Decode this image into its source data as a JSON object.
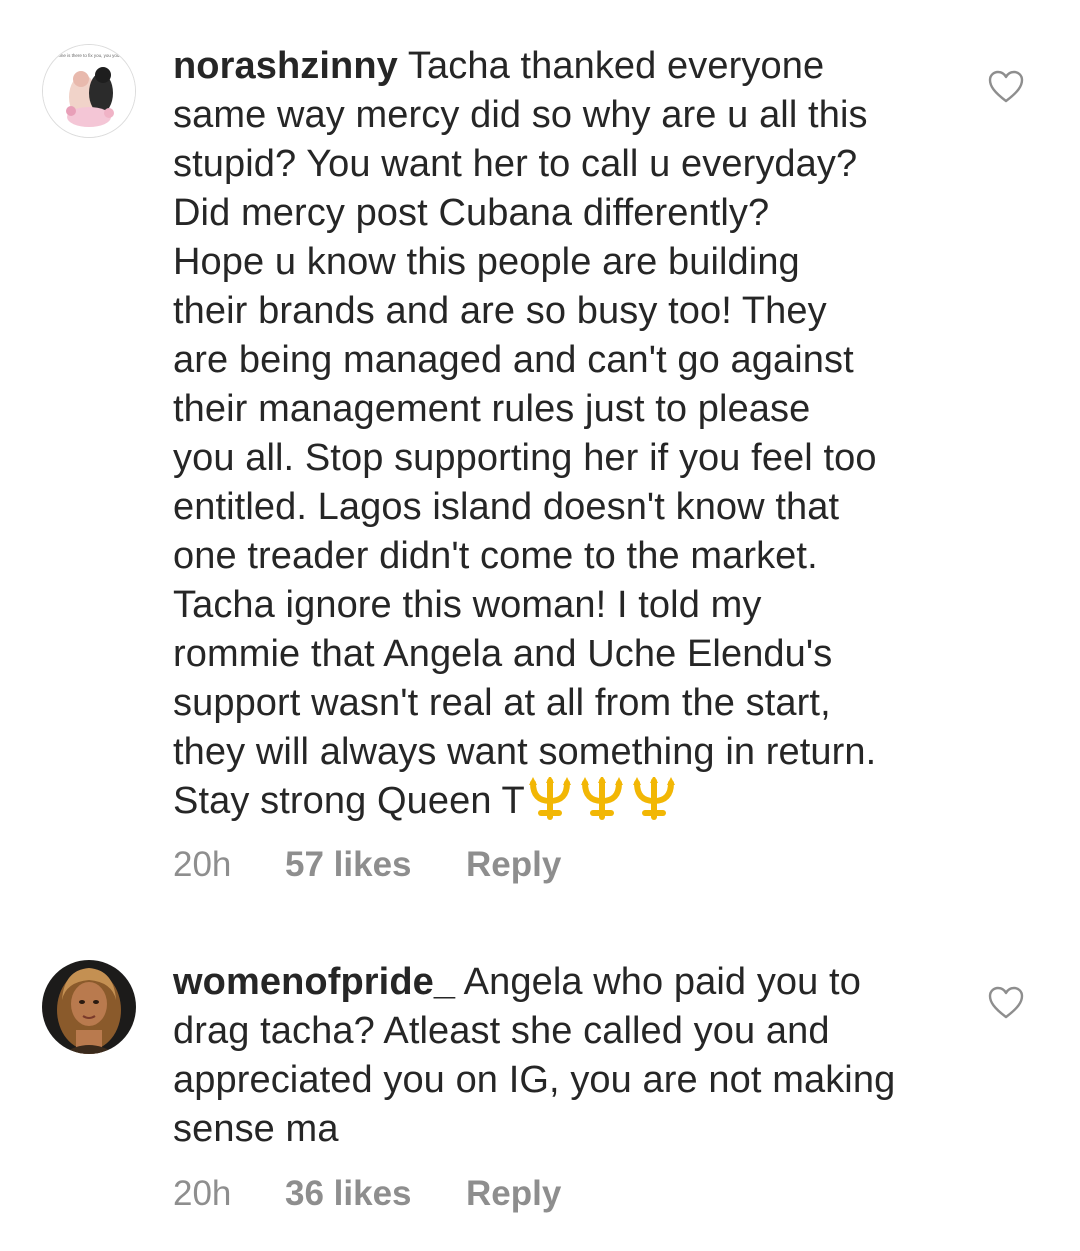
{
  "comments": [
    {
      "username": "norashzinny",
      "lines": [
        "Tacha thanked everyone",
        "same way mercy did so why are u all this",
        "stupid? You want her to call u everyday?",
        "Did mercy post Cubana differently?",
        "Hope u know this people are building",
        "their brands and are so busy too! They",
        "are being managed and can't go against",
        "their management rules just to please",
        "you all. Stop supporting her if you feel too",
        "entitled. Lagos island doesn't know that",
        "one treader didn't come to the market.",
        "Tacha ignore this woman! I told my",
        "rommie that Angela and Uche Elendu's",
        "support wasn't real at all from the start,",
        "they will always want something in return.",
        "Stay strong Queen T"
      ],
      "emojis": [
        "trident-emoji",
        "trident-emoji",
        "trident-emoji"
      ],
      "time": "20h",
      "likes": "57 likes",
      "reply": "Reply",
      "avatar_caption": "no one is there to fix you, you yourself"
    },
    {
      "username": "womenofpride_",
      "lines": [
        "Angela who paid you to",
        "drag tacha? Atleast she called you and",
        "appreciated you on IG, you are not making",
        "sense ma"
      ],
      "time": "20h",
      "likes": "36 likes",
      "reply": "Reply"
    }
  ],
  "icons": {
    "like": "heart-outline-icon"
  },
  "colors": {
    "text": "#262626",
    "meta": "#8e8e8e",
    "emoji": "#f2b705"
  }
}
